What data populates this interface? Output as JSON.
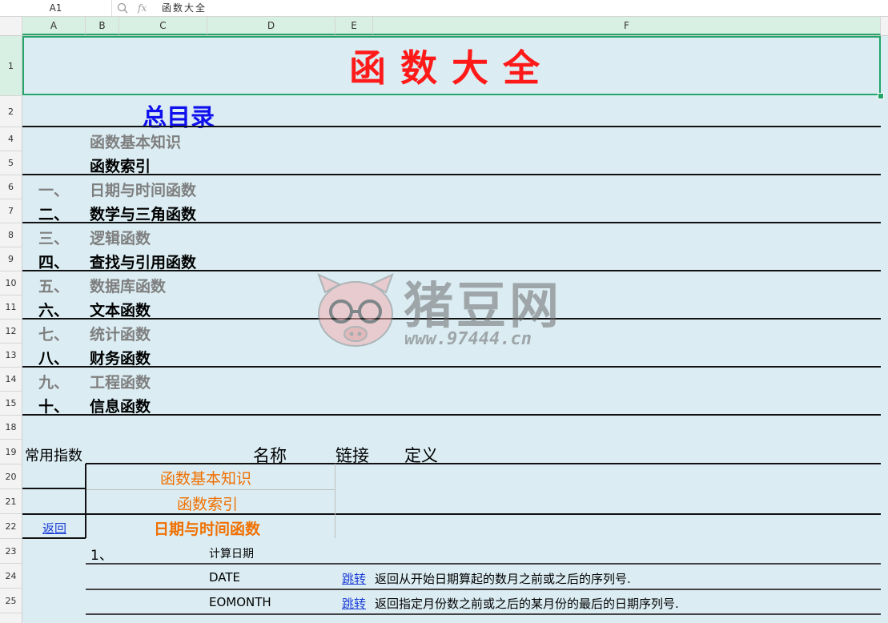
{
  "formula_bar": {
    "name_box": "A1",
    "zoom_icon": "magnifier-icon",
    "fx_icon": "fx-icon",
    "fx_label": "fx",
    "content": "函数大全"
  },
  "columns": [
    "A",
    "B",
    "C",
    "D",
    "E",
    "F"
  ],
  "rows": [
    "1",
    "2",
    "4",
    "5",
    "6",
    "7",
    "8",
    "9",
    "10",
    "11",
    "12",
    "13",
    "14",
    "15",
    "18",
    "19",
    "20",
    "21",
    "22",
    "23",
    "24",
    "25"
  ],
  "sheet": {
    "title": "函数大全",
    "toc_title": "总目录",
    "toc_items": [
      {
        "num": "",
        "label": "函数基本知识",
        "style": "gray"
      },
      {
        "num": "",
        "label": "函数索引",
        "style": "black"
      },
      {
        "num": "一、",
        "label": "日期与时间函数",
        "style": "gray"
      },
      {
        "num": "二、",
        "label": "数学与三角函数",
        "style": "black"
      },
      {
        "num": "三、",
        "label": "逻辑函数",
        "style": "gray"
      },
      {
        "num": "四、",
        "label": "查找与引用函数",
        "style": "black"
      },
      {
        "num": "五、",
        "label": "数据库函数",
        "style": "gray"
      },
      {
        "num": "六、",
        "label": "文本函数",
        "style": "black"
      },
      {
        "num": "七、",
        "label": "统计函数",
        "style": "gray"
      },
      {
        "num": "八、",
        "label": "财务函数",
        "style": "black"
      },
      {
        "num": "九、",
        "label": "工程函数",
        "style": "gray"
      },
      {
        "num": "十、",
        "label": "信息函数",
        "style": "black"
      }
    ],
    "header_row": {
      "col_a": "常用指数",
      "name": "名称",
      "link": "链接",
      "def": "定义"
    },
    "link_items": [
      "函数基本知识",
      "函数索引"
    ],
    "back_link": "返回",
    "section_title": "日期与时间函数",
    "subsection": {
      "num": "1、",
      "label": "计算日期"
    },
    "functions": [
      {
        "name": "DATE",
        "link": "跳转",
        "def": "返回从开始日期算起的数月之前或之后的序列号."
      },
      {
        "name": "EOMONTH",
        "link": "跳转",
        "def": "返回指定月份数之前或之后的某月份的最后的日期序列号."
      }
    ]
  },
  "watermark": {
    "text": "猪豆网",
    "url": "www.97444.cn",
    "icon": "pig-logo-icon"
  }
}
